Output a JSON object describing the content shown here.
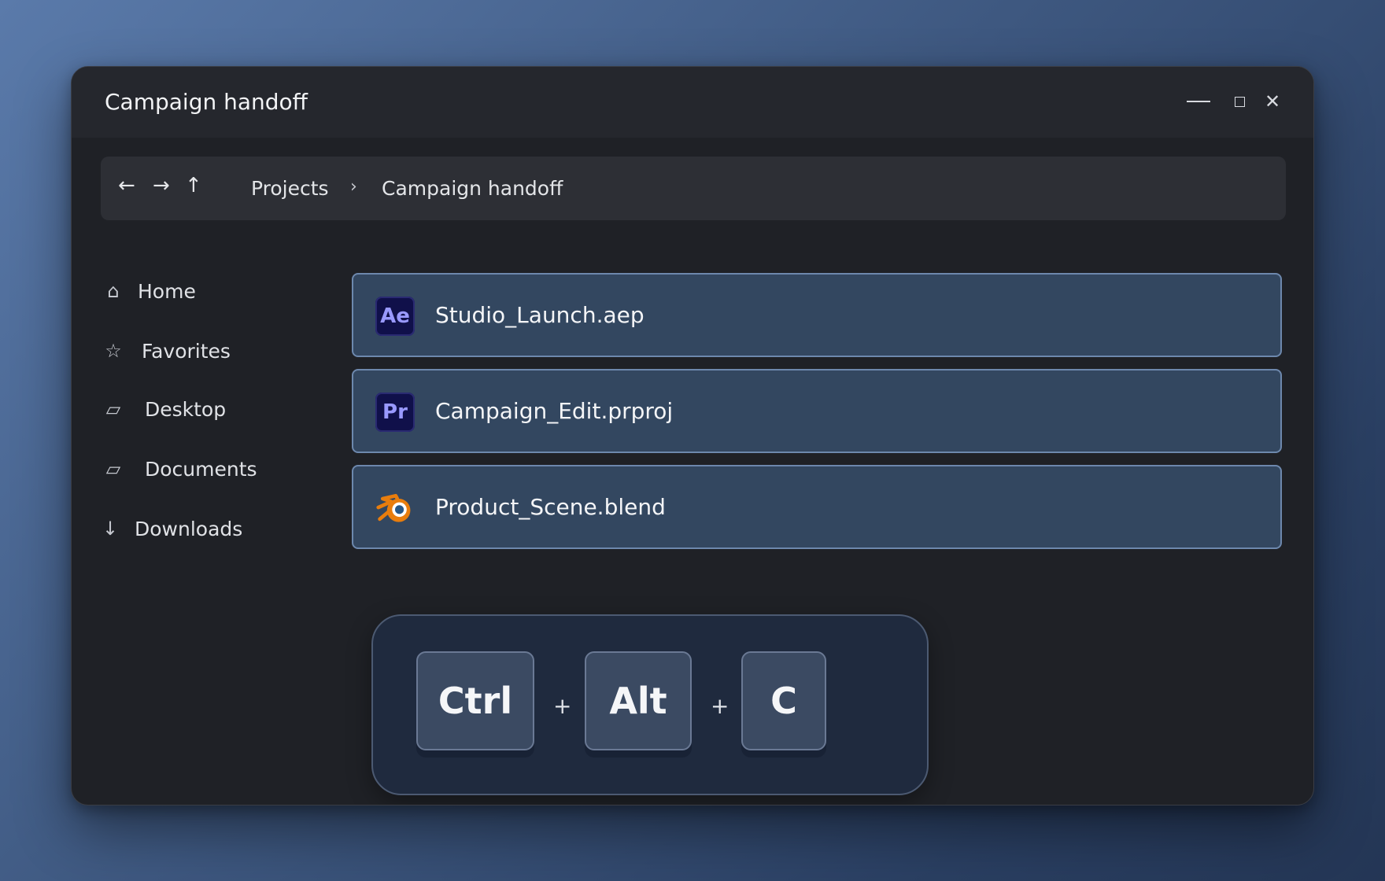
{
  "window": {
    "title": "Campaign handoff",
    "controls": {
      "minimize": "—",
      "maximize": "□",
      "close": "✕"
    }
  },
  "navbar": {
    "back_icon": "←",
    "forward_icon": "→",
    "up_icon": "↑",
    "breadcrumb": [
      "Projects",
      "Campaign handoff"
    ],
    "separator": "›"
  },
  "sidebar": {
    "items": [
      {
        "label": "Home",
        "icon": "⌂",
        "icon_name": "home-icon"
      },
      {
        "label": "Favorites",
        "icon": "☆",
        "icon_name": "star-icon"
      },
      {
        "label": "Desktop",
        "icon": "▱",
        "icon_name": "monitor-icon"
      },
      {
        "label": "Documents",
        "icon": "▱",
        "icon_name": "folder-icon"
      },
      {
        "label": "Downloads",
        "icon": "↓",
        "icon_name": "download-icon"
      }
    ]
  },
  "files": [
    {
      "name": "Studio_Launch.aep",
      "icon_text": "Ae",
      "icon_name": "after-effects-icon"
    },
    {
      "name": "Campaign_Edit.prproj",
      "icon_text": "Pr",
      "icon_name": "premiere-pro-icon"
    },
    {
      "name": "Product_Scene.blend",
      "icon_text": "",
      "icon_name": "blender-icon"
    }
  ],
  "shortcut": {
    "keys": [
      "Ctrl",
      "Alt",
      "C"
    ],
    "plus": "+"
  },
  "colors": {
    "file_row_bg": "#334760",
    "file_row_border": "#6d88ad",
    "blender_orange": "#e87d0d",
    "adobe_icon_bg": "#10104a",
    "adobe_icon_text": "#9999ff"
  }
}
